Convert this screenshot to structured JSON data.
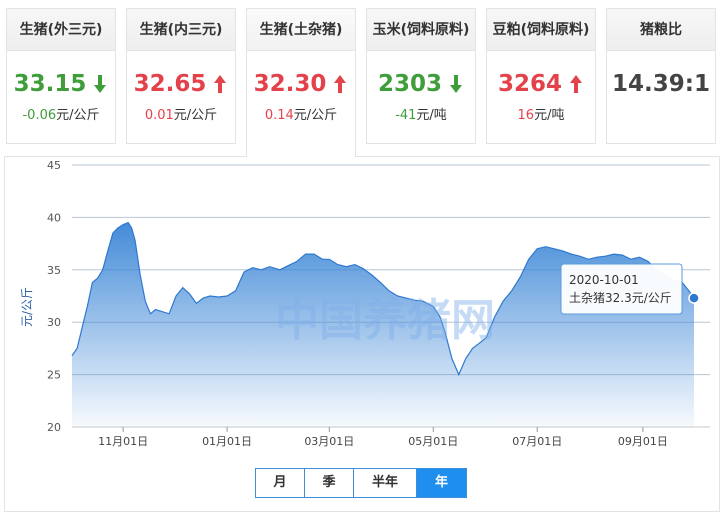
{
  "cards": [
    {
      "title": "生猪(外三元)",
      "value": "33.15",
      "change_num": "-0.06",
      "change_unit": "元/公斤",
      "direction": "down"
    },
    {
      "title": "生猪(内三元)",
      "value": "32.65",
      "change_num": "0.01",
      "change_unit": "元/公斤",
      "direction": "up"
    },
    {
      "title": "生猪(土杂猪)",
      "value": "32.30",
      "change_num": "0.14",
      "change_unit": "元/公斤",
      "direction": "up"
    },
    {
      "title": "玉米(饲料原料)",
      "value": "2303",
      "change_num": "-41",
      "change_unit": "元/吨",
      "direction": "down"
    },
    {
      "title": "豆粕(饲料原料)",
      "value": "3264",
      "change_num": "16",
      "change_unit": "元/吨",
      "direction": "up"
    },
    {
      "title": "猪粮比",
      "value": "14.39:1",
      "change_num": "",
      "change_unit": "",
      "direction": "neutral"
    }
  ],
  "active_card": 2,
  "colors": {
    "up": "#e4424a",
    "down": "#3f9d3a",
    "accent": "#1f8fef",
    "series": "#3a85d6"
  },
  "watermark": "中国养猪网",
  "range_buttons": [
    "月",
    "季",
    "半年",
    "年"
  ],
  "active_range": 3,
  "chart_data": {
    "type": "area",
    "ylabel": "元/公斤",
    "ylim": [
      20,
      45
    ],
    "yticks": [
      20,
      25,
      30,
      35,
      40,
      45
    ],
    "xlim": [
      "2019-10-02",
      "2020-10-01"
    ],
    "xticks": [
      {
        "date": "2019-11-01",
        "label": "11月01日"
      },
      {
        "date": "2020-01-01",
        "label": "01月01日"
      },
      {
        "date": "2020-03-01",
        "label": "03月01日"
      },
      {
        "date": "2020-05-01",
        "label": "05月01日"
      },
      {
        "date": "2020-07-01",
        "label": "07月01日"
      },
      {
        "date": "2020-09-01",
        "label": "09月01日"
      }
    ],
    "grid": true,
    "series": [
      {
        "name": "土杂猪",
        "points": [
          [
            "2019-10-02",
            26.8
          ],
          [
            "2019-10-05",
            27.5
          ],
          [
            "2019-10-08",
            29.5
          ],
          [
            "2019-10-11",
            31.5
          ],
          [
            "2019-10-14",
            33.8
          ],
          [
            "2019-10-17",
            34.2
          ],
          [
            "2019-10-20",
            35.0
          ],
          [
            "2019-10-23",
            36.8
          ],
          [
            "2019-10-26",
            38.5
          ],
          [
            "2019-10-29",
            39.0
          ],
          [
            "2019-11-01",
            39.3
          ],
          [
            "2019-11-04",
            39.5
          ],
          [
            "2019-11-06",
            39.0
          ],
          [
            "2019-11-08",
            37.8
          ],
          [
            "2019-11-11",
            34.5
          ],
          [
            "2019-11-14",
            32.0
          ],
          [
            "2019-11-17",
            30.8
          ],
          [
            "2019-11-20",
            31.2
          ],
          [
            "2019-11-24",
            31.0
          ],
          [
            "2019-11-28",
            30.8
          ],
          [
            "2019-12-02",
            32.5
          ],
          [
            "2019-12-06",
            33.3
          ],
          [
            "2019-12-10",
            32.7
          ],
          [
            "2019-12-14",
            31.8
          ],
          [
            "2019-12-18",
            32.3
          ],
          [
            "2019-12-22",
            32.5
          ],
          [
            "2019-12-27",
            32.4
          ],
          [
            "2020-01-01",
            32.5
          ],
          [
            "2020-01-06",
            33.0
          ],
          [
            "2020-01-11",
            34.8
          ],
          [
            "2020-01-16",
            35.2
          ],
          [
            "2020-01-21",
            35.0
          ],
          [
            "2020-01-26",
            35.3
          ],
          [
            "2020-02-01",
            35.0
          ],
          [
            "2020-02-06",
            35.4
          ],
          [
            "2020-02-11",
            35.8
          ],
          [
            "2020-02-16",
            36.5
          ],
          [
            "2020-02-21",
            36.5
          ],
          [
            "2020-02-26",
            36.0
          ],
          [
            "2020-03-01",
            36.0
          ],
          [
            "2020-03-06",
            35.5
          ],
          [
            "2020-03-11",
            35.3
          ],
          [
            "2020-03-16",
            35.5
          ],
          [
            "2020-03-21",
            35.1
          ],
          [
            "2020-03-26",
            34.5
          ],
          [
            "2020-03-31",
            33.8
          ],
          [
            "2020-04-05",
            33.0
          ],
          [
            "2020-04-10",
            32.5
          ],
          [
            "2020-04-15",
            32.3
          ],
          [
            "2020-04-20",
            32.1
          ],
          [
            "2020-04-25",
            32.0
          ],
          [
            "2020-05-01",
            31.5
          ],
          [
            "2020-05-05",
            30.5
          ],
          [
            "2020-05-08",
            29.0
          ],
          [
            "2020-05-12",
            26.5
          ],
          [
            "2020-05-16",
            25.0
          ],
          [
            "2020-05-20",
            26.5
          ],
          [
            "2020-05-24",
            27.5
          ],
          [
            "2020-05-28",
            28.0
          ],
          [
            "2020-06-01",
            28.5
          ],
          [
            "2020-06-06",
            30.5
          ],
          [
            "2020-06-11",
            32.0
          ],
          [
            "2020-06-16",
            33.0
          ],
          [
            "2020-06-21",
            34.3
          ],
          [
            "2020-06-26",
            36.0
          ],
          [
            "2020-07-01",
            37.0
          ],
          [
            "2020-07-06",
            37.2
          ],
          [
            "2020-07-11",
            37.0
          ],
          [
            "2020-07-16",
            36.8
          ],
          [
            "2020-07-21",
            36.5
          ],
          [
            "2020-07-26",
            36.3
          ],
          [
            "2020-07-31",
            36.0
          ],
          [
            "2020-08-05",
            36.2
          ],
          [
            "2020-08-10",
            36.3
          ],
          [
            "2020-08-15",
            36.5
          ],
          [
            "2020-08-20",
            36.4
          ],
          [
            "2020-08-25",
            36.0
          ],
          [
            "2020-08-30",
            36.2
          ],
          [
            "2020-09-04",
            35.8
          ],
          [
            "2020-09-09",
            35.0
          ],
          [
            "2020-09-14",
            34.5
          ],
          [
            "2020-09-19",
            34.0
          ],
          [
            "2020-09-24",
            33.8
          ],
          [
            "2020-09-28",
            33.0
          ],
          [
            "2020-10-01",
            32.3
          ]
        ]
      }
    ],
    "tooltip": {
      "date": "2020-10-01",
      "label": "土杂猪32.3元/公斤",
      "value": 32.3
    }
  }
}
